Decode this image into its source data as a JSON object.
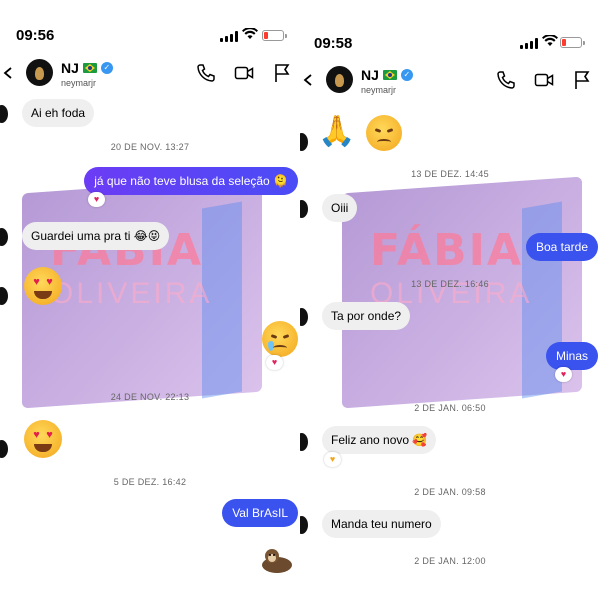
{
  "colors": {
    "accent_purple": "#6c3cf5",
    "accent_blue": "#3a52ee",
    "incoming_bg": "#efefef",
    "battery_low": "#ff3b30",
    "verified": "#3897f0"
  },
  "left": {
    "time": "09:56",
    "header": {
      "name": "NJ",
      "handle": "neymarjr"
    },
    "messages": {
      "m1": "Ai eh foda",
      "ts1": "20 DE NOV. 13:27",
      "m2": "já que não teve blusa da seleção 🫠",
      "m3": "Guardei uma pra ti 😂😝",
      "ts2": "24 DE NOV. 22:13",
      "ts3": "5 DE DEZ. 16:42",
      "m4": "Val BrAsIL"
    }
  },
  "right": {
    "time": "09:58",
    "header": {
      "name": "NJ",
      "handle": "neymarjr"
    },
    "messages": {
      "ts1": "13 DE DEZ. 14:45",
      "m1": "Oiii",
      "m2": "Boa tarde",
      "ts2": "13 DE DEZ. 16:46",
      "m3": "Ta por onde?",
      "m4": "Minas",
      "ts3": "2 DE JAN. 06:50",
      "m5": "Feliz ano novo 🥰",
      "ts4": "2 DE JAN. 09:58",
      "m6": "Manda teu numero",
      "ts5": "2 DE JAN. 12:00"
    }
  },
  "watermark": {
    "line1": "FÁBIA",
    "line2": "OLIVEIRA"
  },
  "icons": [
    "back-chevron-icon",
    "phone-icon",
    "video-icon",
    "flag-icon",
    "verified-icon",
    "brazil-flag-icon",
    "heart-icon"
  ]
}
